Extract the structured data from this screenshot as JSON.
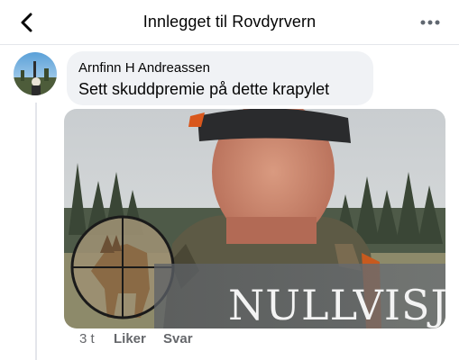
{
  "header": {
    "title": "Innlegget til Rovdyrvern"
  },
  "comment": {
    "author": "Arnfinn H Andreassen",
    "text": "Sett skuddpremie på dette krapylet",
    "attachment_text": "NULLVISJON",
    "timestamp": "3 t",
    "like_label": "Liker",
    "reply_label": "Svar"
  },
  "icons": {
    "back": "chevron-left-icon",
    "more": "more-horizontal-icon",
    "crosshair": "crosshair-icon"
  },
  "colors": {
    "bubble": "#f0f2f5",
    "meta_text": "#65676b",
    "divider": "#e4e6eb"
  }
}
